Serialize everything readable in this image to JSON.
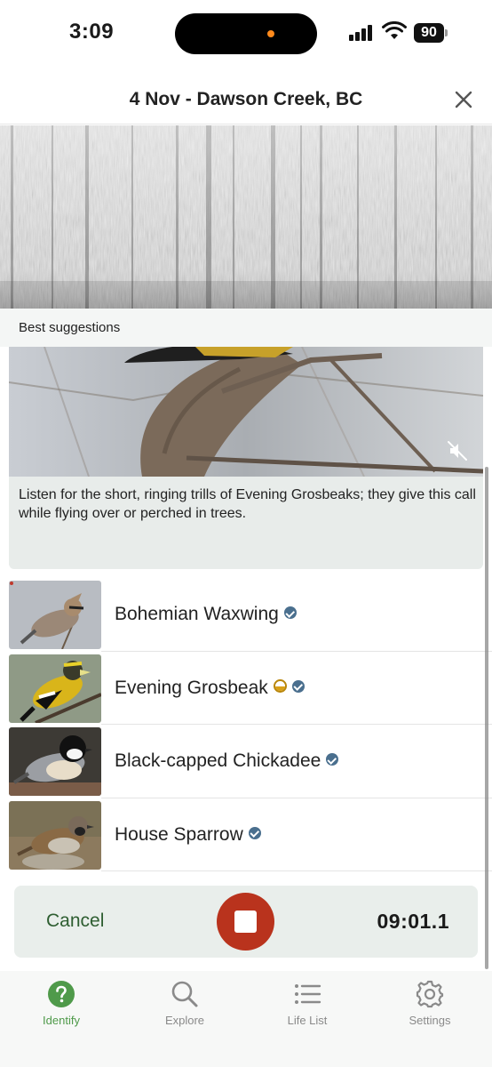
{
  "status_bar": {
    "time": "3:09",
    "battery": "90",
    "icons": [
      "signal-icon",
      "wifi-icon",
      "battery-icon"
    ]
  },
  "header": {
    "title": "4 Nov - Dawson Creek, BC",
    "close_icon": "close-icon"
  },
  "suggestions": {
    "section_label": "Best suggestions",
    "info_card": {
      "text": "Listen for the short, ringing trills of Evening Grosbeaks; they give this call while flying over or perched in trees.",
      "mute_icon": "speaker-muted-icon"
    },
    "species": [
      {
        "name": "Bohemian Waxwing",
        "verified": true,
        "rarity": false
      },
      {
        "name": "Evening Grosbeak",
        "verified": true,
        "rarity": true
      },
      {
        "name": "Black-capped Chickadee",
        "verified": true,
        "rarity": false
      },
      {
        "name": "House Sparrow",
        "verified": true,
        "rarity": false
      }
    ]
  },
  "recording": {
    "cancel_label": "Cancel",
    "timer": "09:01.1",
    "stop_icon": "stop-icon"
  },
  "tab_bar": {
    "tabs": [
      {
        "label": "Identify",
        "icon": "identify-question-icon",
        "active": true
      },
      {
        "label": "Explore",
        "icon": "search-icon",
        "active": false
      },
      {
        "label": "Life List",
        "icon": "list-icon",
        "active": false
      },
      {
        "label": "Settings",
        "icon": "gear-icon",
        "active": false
      }
    ]
  },
  "colors": {
    "accent_green": "#4f9a4a",
    "cancel_green": "#2e5e31",
    "record_red": "#b9331d",
    "verified_blue": "#4a6f8e",
    "rarity_gold": "#d9a017"
  }
}
